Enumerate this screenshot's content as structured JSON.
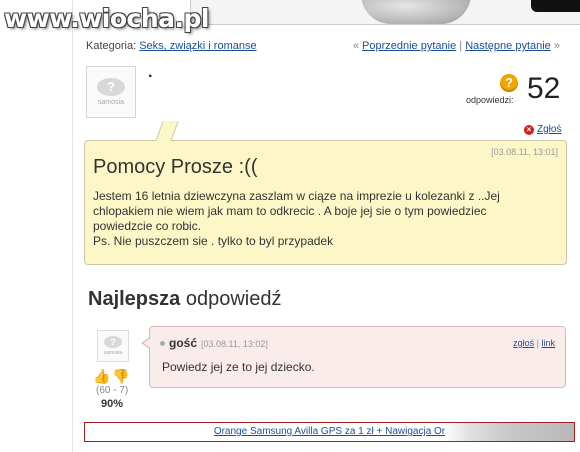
{
  "watermark": "www.wiocha.pl",
  "breadcrumb": {
    "prefix": "Kategoria:",
    "category": "Seks, związki i romanse"
  },
  "question_nav": {
    "prev": "Poprzednie pytanie",
    "separator": "|",
    "next": "Następne pytanie",
    "prev_arrow": "«",
    "next_arrow": "»"
  },
  "question": {
    "author": "·",
    "avatar_brand": "samosia",
    "answers_label": "odpowiedzi:",
    "answers_count": "52",
    "report_label": "Zgłoś",
    "date": "[03.08.11, 13:01]",
    "title": "Pomocy Prosze :((",
    "body_lines": [
      "Jestem 16 letnia dziewczyna zaszlam w ciąze na imprezie u kolezanki z ..Jej",
      "chlopakiem nie wiem jak mam to odkrecic . A boje jej sie o tym powiedziec",
      "powiedzcie co robic.",
      "Ps. Nie puszczem sie . tylko to byl przypadek"
    ]
  },
  "best_answer": {
    "heading_bold": "Najlepsza",
    "heading_rest": " odpowiedź",
    "author": "gość",
    "date": "[03.08.11, 13:02]",
    "report": "zgłoś",
    "link": "link",
    "separator": "|",
    "text": "Powiedz jej ze to jej dziecko.",
    "votes": "(60 - 7)",
    "percent": "90%",
    "avatar_brand": "samosia"
  },
  "bottom_ad": {
    "text": "Orange Samsung Avilla GPS za 1 zł + Nawigacja Or"
  },
  "icons": {
    "question_mark": "?",
    "report": "×",
    "thumb_up": "👍",
    "thumb_down": "👎"
  },
  "colors": {
    "link": "#1a4f9a",
    "question_bg": "#fdf7c8",
    "answer_bg": "#fbecec",
    "answers_icon": "#f0a500",
    "report_icon": "#d2211b"
  }
}
